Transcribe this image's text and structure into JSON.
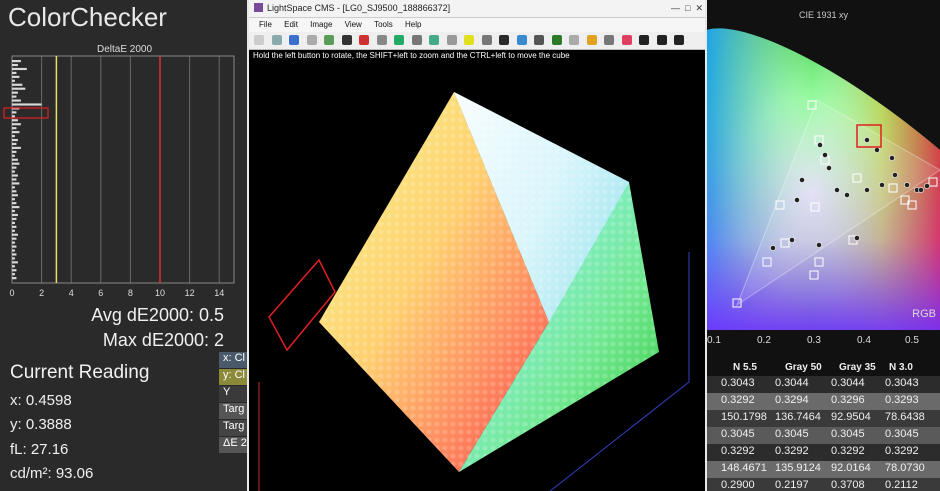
{
  "colorchecker": {
    "title": "ColorChecker",
    "chart_title": "DeltaE 2000",
    "x_ticks": [
      "0",
      "2",
      "4",
      "6",
      "8",
      "10",
      "12",
      "14"
    ],
    "avg_label": "Avg dE2000: 0.5",
    "max_label": "Max dE2000: 2",
    "current_title": "Current Reading",
    "reading_x": "x: 0.4598",
    "reading_y": "y: 0.3888",
    "reading_fl": "fL: 27.16",
    "reading_cdm2": "cd/m²: 93.06",
    "side_rows": [
      "x: Cl",
      "y: Cl",
      "Y",
      "Targ",
      "Targ",
      "ΔE 2"
    ],
    "threshold_colors": {
      "low": "#e8e066",
      "high": "#e03030"
    }
  },
  "chart_data": {
    "type": "bar",
    "title": "DeltaE 2000",
    "orientation": "horizontal",
    "xlim": [
      0,
      15
    ],
    "x_ticks": [
      0,
      2,
      4,
      6,
      8,
      10,
      12,
      14
    ],
    "threshold_lines": [
      3,
      10
    ],
    "values": [
      0.6,
      0.4,
      1.0,
      0.3,
      0.5,
      0.2,
      0.7,
      0.9,
      0.4,
      0.3,
      0.6,
      2.0,
      0.5,
      0.3,
      0.2,
      0.4,
      0.6,
      0.3,
      0.5,
      0.2,
      0.4,
      0.3,
      0.6,
      0.3,
      0.2,
      0.4,
      0.5,
      0.3,
      0.2,
      0.4,
      0.3,
      0.5,
      0.2,
      0.3,
      0.4,
      0.2,
      0.3,
      0.5,
      0.2,
      0.4,
      0.3,
      0.2,
      0.3,
      0.2,
      0.4,
      0.3,
      0.2,
      0.3,
      0.2,
      0.3,
      0.2,
      0.4,
      0.2,
      0.3,
      0.2,
      0.3
    ]
  },
  "lightspace": {
    "window_title": "LightSpace CMS - [LG0_SJ9500_188866372]",
    "menus": [
      "File",
      "Edit",
      "Image",
      "View",
      "Tools",
      "Help"
    ],
    "hint": "Hold the left button to rotate, the SHIFT+left to zoom and the CTRL+left to move the cube"
  },
  "cie": {
    "title": "CIE 1931 xy",
    "rgb_label": "RGB",
    "x_ticks": [
      "0.1",
      "0.2",
      "0.3",
      "0.4",
      "0.5"
    ],
    "columns": [
      "N 5.5",
      "Gray 50",
      "Gray 35",
      "N 3.0"
    ],
    "rows": [
      [
        "0.3043",
        "0.3044",
        "0.3044",
        "0.3043"
      ],
      [
        "0.3292",
        "0.3294",
        "0.3296",
        "0.3293"
      ],
      [
        "150.1798",
        "136.7464",
        "92.9504",
        "78.6438"
      ],
      [
        "0.3045",
        "0.3045",
        "0.3045",
        "0.3045"
      ],
      [
        "0.3292",
        "0.3292",
        "0.3292",
        "0.3292"
      ],
      [
        "148.4671",
        "135.9124",
        "92.0164",
        "78.0730"
      ],
      [
        "0.2900",
        "0.2197",
        "0.3708",
        "0.2112"
      ]
    ]
  }
}
